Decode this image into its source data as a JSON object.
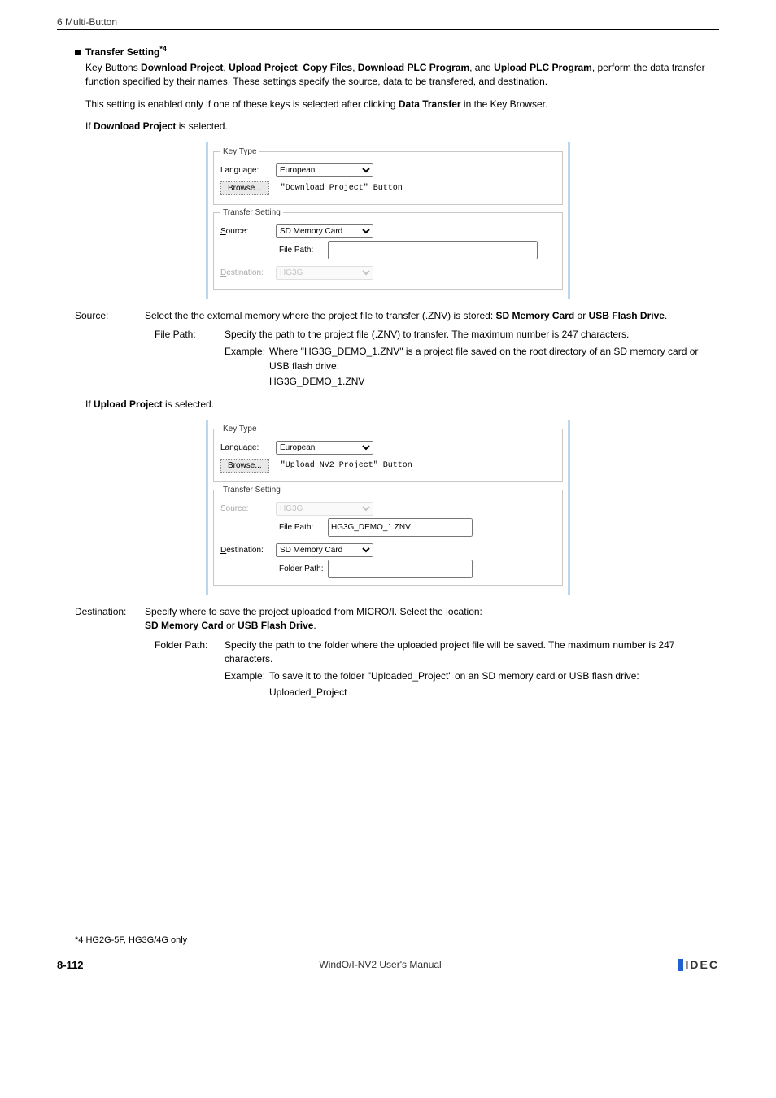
{
  "header": "6 Multi-Button",
  "section": {
    "title": "Transfer Setting",
    "sup": "*4",
    "para1_pre": "Key Buttons ",
    "para1_b1": "Download Project",
    "para1_sep": ", ",
    "para1_b2": "Upload Project",
    "para1_b3": "Copy Files",
    "para1_b4": "Download PLC Program",
    "para1_mid": ", and ",
    "para1_b5": "Upload PLC Program",
    "para1_post": ", perform the data transfer function specified by their names. These settings specify the source, data to be transfered, and destination.",
    "para2_pre": "This setting is enabled only if one of these keys is selected after clicking ",
    "para2_b": "Data Transfer",
    "para2_post": " in the Key Browser.",
    "ifdl_pre": "If ",
    "ifdl_b": "Download Project",
    "ifdl_post": " is selected.",
    "ifup_pre": "If ",
    "ifup_b": "Upload Project",
    "ifup_post": " is selected."
  },
  "panel1": {
    "legend1": "Key Type",
    "lang_label": "Language:",
    "lang_value": "European",
    "browse": "Browse...",
    "btn_text": "\"Download Project\" Button",
    "legend2": "Transfer Setting",
    "src_label": "Source:",
    "src_value": "SD Memory Card",
    "filepath_label": "File Path:",
    "filepath_value": "",
    "dst_label": "Destination:",
    "dst_value": "HG3G"
  },
  "panel2": {
    "legend1": "Key Type",
    "lang_label": "Language:",
    "lang_value": "European",
    "browse": "Browse...",
    "btn_text": "\"Upload NV2 Project\" Button",
    "legend2": "Transfer Setting",
    "src_label": "Source:",
    "src_value": "HG3G",
    "filepath_label": "File Path:",
    "filepath_value": "HG3G_DEMO_1.ZNV",
    "dst_label": "Destination:",
    "dst_value": "SD Memory Card",
    "folder_label": "Folder Path:",
    "folder_value": ""
  },
  "src_def": {
    "term": "Source:",
    "txt_pre": "Select the the external memory where the project file to transfer (.ZNV) is stored: ",
    "b1": "SD Memory Card",
    "mid": " or ",
    "b2": "USB Flash Drive",
    "post": "."
  },
  "fp_def": {
    "term": "File Path:",
    "txt": "Specify the path to the project file (.ZNV) to transfer. The maximum number is 247 characters.",
    "ex_term": "Example:",
    "ex_txt": "Where \"HG3G_DEMO_1.ZNV\" is a project file saved on the root directory of an SD memory card or USB flash drive:",
    "ex_val": "HG3G_DEMO_1.ZNV"
  },
  "dst_def": {
    "term": "Destination:",
    "txt_pre": "Specify where to save the project uploaded from MICRO/I. Select the location:",
    "b1": "SD Memory Card",
    "mid": " or ",
    "b2": "USB Flash Drive",
    "post": "."
  },
  "fldr_def": {
    "term": "Folder Path:",
    "txt": "Specify the path to the folder where the uploaded project file will be saved. The maximum number is 247 characters.",
    "ex_term": "Example:",
    "ex_txt": "To save it to the folder \"Uploaded_Project\" on an SD memory card or USB flash drive:",
    "ex_val": "Uploaded_Project"
  },
  "footnote": "*4  HG2G-5F, HG3G/4G only",
  "footer": {
    "page": "8-112",
    "manual": "WindO/I-NV2 User's Manual",
    "logo": "IDEC"
  }
}
